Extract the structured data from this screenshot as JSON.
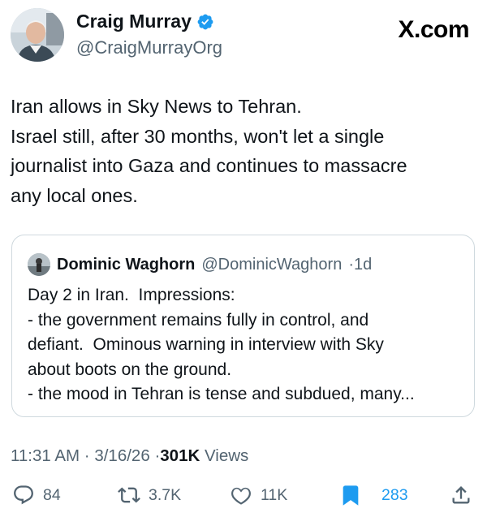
{
  "post": {
    "author_name": "Craig Murray",
    "author_handle": "@CraigMurrayOrg",
    "site_logo": "X.com",
    "text_lines": [
      "Iran allows in Sky News to Tehran.",
      "Israel still, after 30 months, won't let a single",
      "journalist into Gaza and continues to massacre",
      "any local ones."
    ],
    "verified_icon": "verified-badge-icon",
    "verified_color": "#1d9bf0"
  },
  "quote": {
    "author_name": "Dominic Waghorn",
    "author_handle": "@DominicWaghorn",
    "separator": "·",
    "time": "1d",
    "lines": [
      "Day 2 in Iran.  Impressions:",
      "- the government remains fully in control, and",
      "defiant.  Ominous warning in interview with Sky",
      "about boots on the ground.",
      "- the mood in Tehran is tense and subdued, many..."
    ]
  },
  "meta": {
    "time": "11:31 AM",
    "separator": "·",
    "date": "3/16/26",
    "views_count": "301K",
    "views_label": "Views"
  },
  "actions": {
    "replies": "84",
    "reposts": "3.7K",
    "likes": "11K",
    "bookmarks": "283",
    "icons": [
      "reply-icon",
      "repost-icon",
      "like-icon",
      "bookmark-icon",
      "share-icon"
    ],
    "accent": "#1d9bf0"
  }
}
